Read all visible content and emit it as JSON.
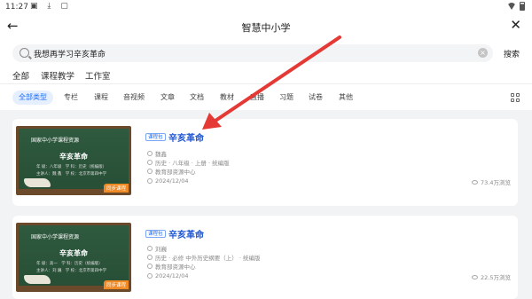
{
  "status_bar": {
    "time": "11:27"
  },
  "header": {
    "title": "智慧中小学",
    "back_icon": "arrow-left-icon",
    "close_icon": "close-icon"
  },
  "search": {
    "value": "我想再学习辛亥革命",
    "button_label": "搜索"
  },
  "tabs": [
    {
      "label": "全部",
      "active": true
    },
    {
      "label": "课程教学",
      "active": false
    },
    {
      "label": "工作室",
      "active": false
    }
  ],
  "filters": [
    {
      "label": "全部类型",
      "active": true
    },
    {
      "label": "专栏",
      "active": false
    },
    {
      "label": "课程",
      "active": false
    },
    {
      "label": "音视频",
      "active": false
    },
    {
      "label": "文章",
      "active": false
    },
    {
      "label": "文档",
      "active": false
    },
    {
      "label": "教材",
      "active": false
    },
    {
      "label": "直播",
      "active": false
    },
    {
      "label": "习题",
      "active": false
    },
    {
      "label": "试卷",
      "active": false
    },
    {
      "label": "其他",
      "active": false
    }
  ],
  "results": [
    {
      "thumb_header": "国家中小学课程资源",
      "thumb_title": "辛亥革命",
      "thumb_details": "年 级：八年级   学 科：历史（统编版）\n主讲人：魏 鑫   学 校：北京市第四中学",
      "thumb_tag": "同步课程",
      "badge": "课程包",
      "title": "辛亥革命",
      "teacher": "魏鑫",
      "subject": "历史 · 八年级 · 上册 · 统编版",
      "source": "教育部资源中心",
      "date": "2024/12/04",
      "views": "73.4万浏览"
    },
    {
      "thumb_header": "国家中小学课程资源",
      "thumb_title": "辛亥革命",
      "thumb_details": "年 级：高一   学 科：历史（统编版）\n主讲人：刘 巍   学 校：北京市第四中学",
      "thumb_tag": "同步课程",
      "badge": "课程包",
      "title": "辛亥革命",
      "teacher": "刘巍",
      "subject": "历史 · 必修 中外历史纲要（上） · 统编版",
      "source": "教育部资源中心",
      "date": "2024/12/04",
      "views": "22.5万浏览"
    }
  ],
  "colors": {
    "accent": "#1e6cf0",
    "annotation_arrow": "#e53935"
  }
}
